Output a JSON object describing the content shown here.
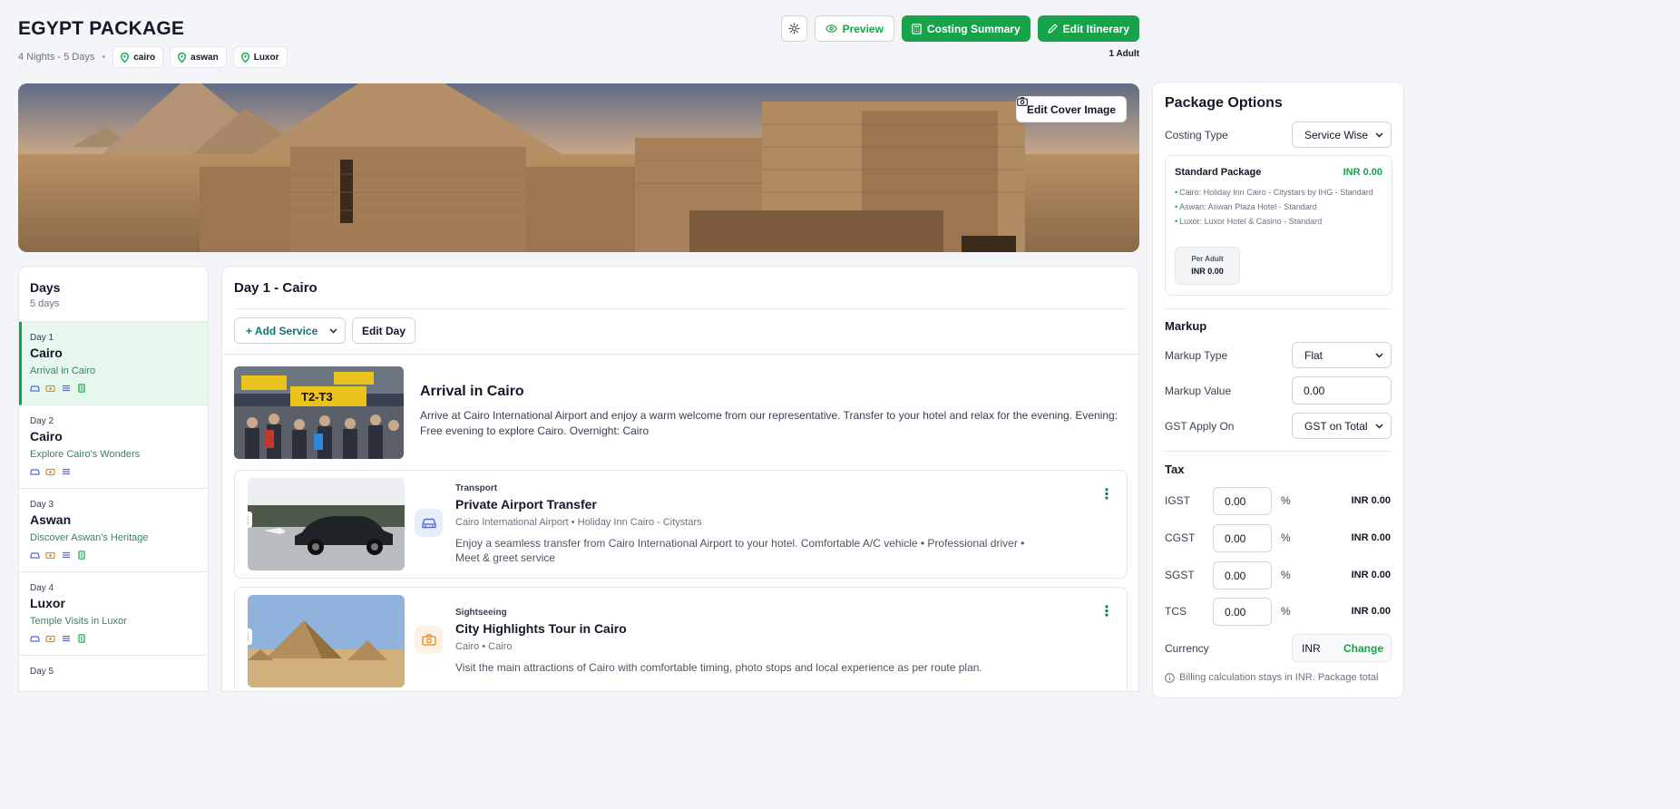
{
  "header": {
    "title": "EGYPT PACKAGE",
    "duration": "4 Nights - 5 Days",
    "locations": [
      "cairo",
      "aswan",
      "Luxor"
    ],
    "travellers": "1 Adult"
  },
  "actions": {
    "preview": "Preview",
    "costing_summary": "Costing Summary",
    "edit_itinerary": "Edit Itinerary",
    "edit_cover": "Edit Cover Image"
  },
  "days": {
    "title": "Days",
    "count": "5 days",
    "items": [
      {
        "label": "Day 1",
        "city": "Cairo",
        "desc": "Arrival in Cairo"
      },
      {
        "label": "Day 2",
        "city": "Cairo",
        "desc": "Explore Cairo's Wonders"
      },
      {
        "label": "Day 3",
        "city": "Aswan",
        "desc": "Discover Aswan's Heritage"
      },
      {
        "label": "Day 4",
        "city": "Luxor",
        "desc": "Temple Visits in Luxor"
      },
      {
        "label": "Day 5",
        "city": "",
        "desc": ""
      }
    ]
  },
  "main": {
    "day_title": "Day 1 - Cairo",
    "add_service": "+ Add Service",
    "edit_day": "Edit Day",
    "intro": {
      "title": "Arrival in Cairo",
      "text": "Arrive at Cairo International Airport and enjoy a warm welcome from our representative. Transfer to your hotel and relax for the evening. Evening: Free evening to explore Cairo. Overnight: Cairo"
    },
    "services": [
      {
        "category": "Transport",
        "name": "Private Airport Transfer",
        "location": "Cairo International Airport • Holiday Inn Cairo - Citystars",
        "desc": "Enjoy a seamless transfer from Cairo International Airport to your hotel. Comfortable A/C vehicle • Professional driver • Meet & greet service"
      },
      {
        "category": "Sightseeing",
        "name": "City Highlights Tour in Cairo",
        "location": "Cairo • Cairo",
        "desc": "Visit the main attractions of Cairo with comfortable timing, photo stops and local experience as per route plan."
      }
    ]
  },
  "options": {
    "title": "Package Options",
    "costing_type_label": "Costing Type",
    "costing_type_value": "Service Wise",
    "standard": {
      "title": "Standard Package",
      "price": "INR 0.00",
      "hotels": [
        "Cairo: Holiday Inn Cairo - Citystars by IHG - Standard",
        "Aswan: Aswan Plaza Hotel - Standard",
        "Luxor: Luxor Hotel & Casino - Standard"
      ],
      "per_adult_label": "Per Adult",
      "per_adult_value": "INR 0.00"
    },
    "markup": {
      "title": "Markup",
      "type_label": "Markup Type",
      "type_value": "Flat",
      "value_label": "Markup Value",
      "value": "0.00",
      "gst_label": "GST Apply On",
      "gst_value": "GST on Total"
    },
    "tax": {
      "title": "Tax",
      "rows": [
        {
          "name": "IGST",
          "value": "0.00",
          "pct": "%",
          "amount": "INR 0.00"
        },
        {
          "name": "CGST",
          "value": "0.00",
          "pct": "%",
          "amount": "INR 0.00"
        },
        {
          "name": "SGST",
          "value": "0.00",
          "pct": "%",
          "amount": "INR 0.00"
        },
        {
          "name": "TCS",
          "value": "0.00",
          "pct": "%",
          "amount": "INR 0.00"
        }
      ]
    },
    "currency_label": "Currency",
    "currency_value": "INR",
    "currency_change": "Change",
    "billing_note": "Billing calculation stays in INR. Package total"
  }
}
